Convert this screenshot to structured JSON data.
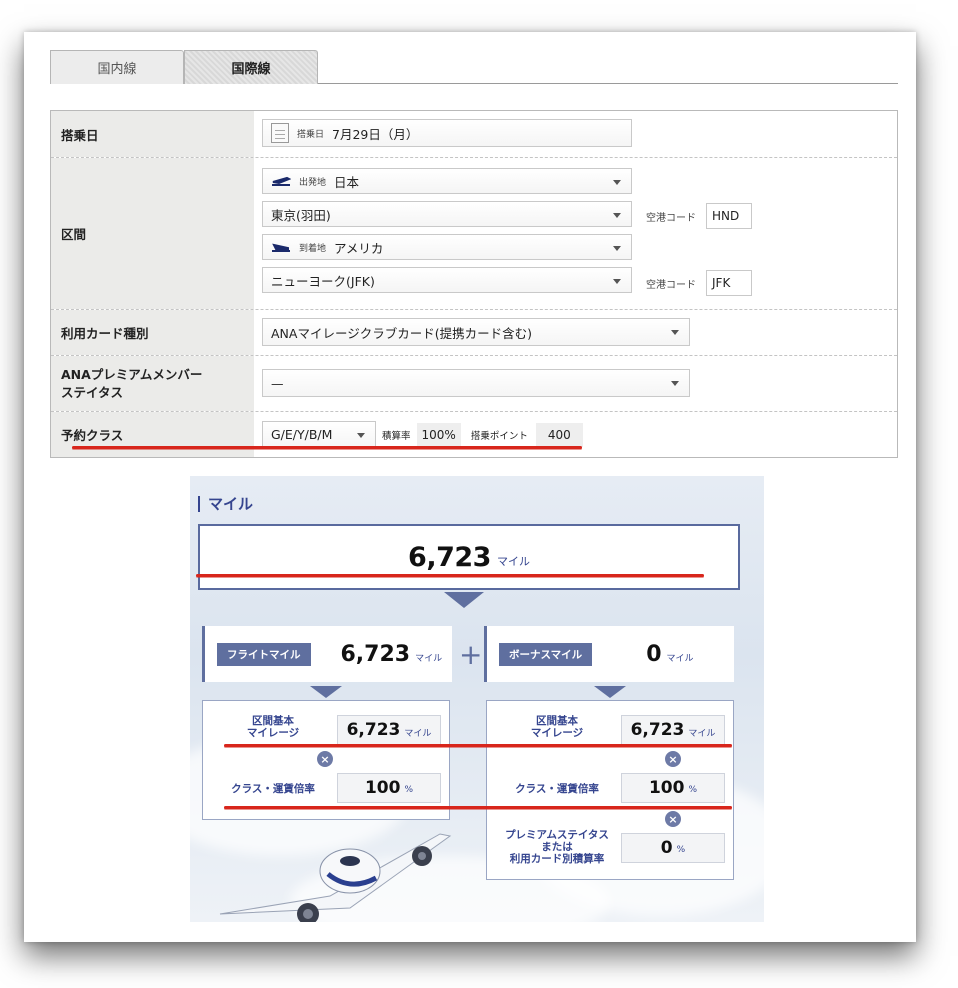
{
  "tabs": [
    {
      "label": "国内線",
      "active": false
    },
    {
      "label": "国際線",
      "active": true
    }
  ],
  "form": {
    "boarding_date": {
      "label": "搭乗日",
      "small_label": "搭乗日",
      "value": "7月29日（月）"
    },
    "route": {
      "label": "区間",
      "origin_region_label": "出発地",
      "origin_region": "日本",
      "origin_airport": "東京(羽田)",
      "origin_code_label": "空港コード",
      "origin_code": "HND",
      "dest_region_label": "到着地",
      "dest_region": "アメリカ",
      "dest_airport": "ニューヨーク(JFK)",
      "dest_code_label": "空港コード",
      "dest_code": "JFK"
    },
    "card_type": {
      "label": "利用カード種別",
      "value": "ANAマイレージクラブカード(提携カード含む)"
    },
    "premium_status": {
      "label_line1": "ANAプレミアムメンバー",
      "label_line2": "ステイタス",
      "value": "—"
    },
    "booking_class": {
      "label": "予約クラス",
      "value": "G/E/Y/B/M",
      "rate_label": "積算率",
      "rate_value": "100%",
      "points_label": "搭乗ポイント",
      "points_value": "400"
    }
  },
  "miles": {
    "title": "マイル",
    "total": "6,723",
    "unit": "マイル",
    "plus": "+",
    "times": "×",
    "flight": {
      "tag": "フライトマイル",
      "value": "6,723",
      "unit": "マイル",
      "base_label_1": "区間基本",
      "base_label_2": "マイレージ",
      "base_value": "6,723",
      "base_unit": "マイル",
      "rate_label": "クラス・運賃倍率",
      "rate_value": "100",
      "rate_unit": "%"
    },
    "bonus": {
      "tag": "ボーナスマイル",
      "value": "0",
      "unit": "マイル",
      "base_label_1": "区間基本",
      "base_label_2": "マイレージ",
      "base_value": "6,723",
      "base_unit": "マイル",
      "rate_label": "クラス・運賃倍率",
      "rate_value": "100",
      "rate_unit": "%",
      "status_label_1": "プレミアムステイタス",
      "status_label_2": "または",
      "status_label_3": "利用カード別積算率",
      "status_value": "0",
      "status_unit": "%"
    }
  },
  "colors": {
    "accent": "#5f6f9f",
    "title": "#35458f",
    "annotation": "#d8261c"
  }
}
